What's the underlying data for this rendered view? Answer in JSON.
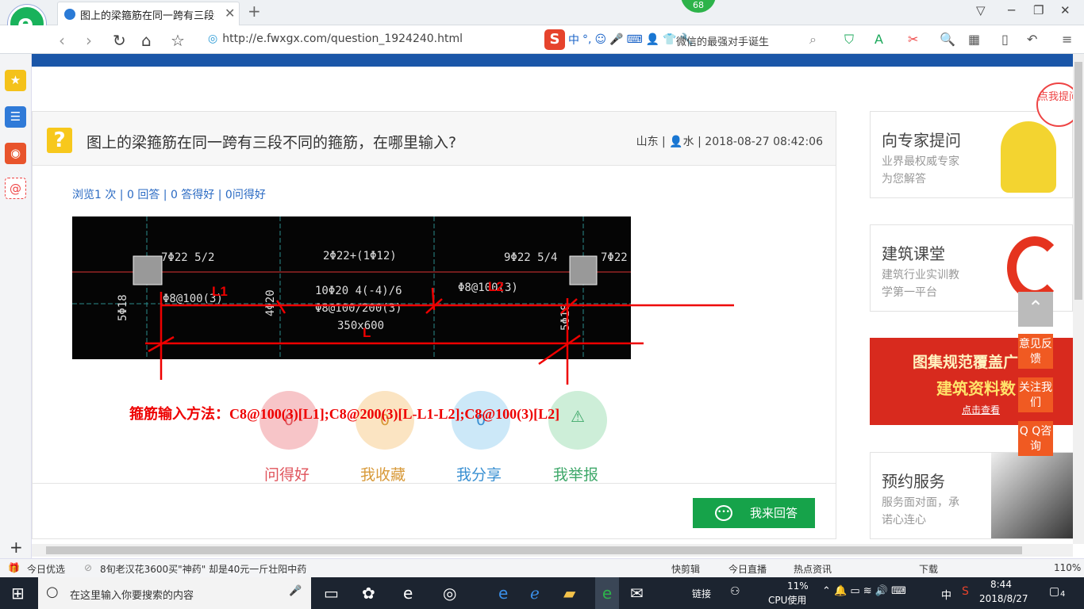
{
  "browser": {
    "tab_title": "图上的梁箍筋在同一跨有三段不同的箍筋",
    "tab_close": "✕",
    "new_tab": "+",
    "badge": "68",
    "url": "http://e.fwxgx.com/question_1924240.html",
    "ime_label": "中",
    "search_text": "微信的最强对手诞生",
    "window_buttons": [
      "▽",
      "─",
      "❐",
      "✕"
    ]
  },
  "question": {
    "icon": "?",
    "title": "图上的梁箍筋在同一跨有三段不同的箍筋，在哪里输入?",
    "meta_location": "山东",
    "meta_user": "水",
    "meta_time": "2018-08-27 08:42:06",
    "stats": "浏览1 次 | 0 回答 | 0 答得好 | 0问得好",
    "method": "箍筋输入方法：C8@100(3)[L1];C8@200(3)[L-L1-L2];C8@100(3)[L2]",
    "cad_labels": {
      "top_left": "7Φ22 5/2",
      "top_mid": "2Φ22+(1Φ12)",
      "top_right": "9Φ22 5/4",
      "top_far_right": "7Φ22",
      "mid_a": "10Φ20 4(-4)/6",
      "mid_b": "Φ8@100/200(3)",
      "mid_c": "350x600",
      "left_stirrup": "Φ8@100(3)",
      "right_stirrup": "Φ8@100(3)",
      "col_left": "5Φ18",
      "col_mid": "4Φ20",
      "col_right": "5Φ18",
      "L1": "L1",
      "L2": "L2",
      "L": "L"
    },
    "actions": [
      {
        "count": "0",
        "label": "问得好",
        "color": "#f7c5c8",
        "text_color": "#e0545c"
      },
      {
        "count": "0",
        "label": "我收藏",
        "color": "#fbe4c2",
        "text_color": "#d89a3a"
      },
      {
        "count": "0",
        "label": "我分享",
        "color": "#cce8f8",
        "text_color": "#3a90d2"
      },
      {
        "count": "",
        "label": "我举报",
        "color": "#cdeed8",
        "text_color": "#3fa86a"
      }
    ],
    "answer_button": "我来回答"
  },
  "sidebar": {
    "cards": [
      {
        "title": "向专家提问",
        "sub": [
          "业界最权威专家",
          "为您解答"
        ]
      },
      {
        "title": "建筑课堂",
        "sub": [
          "建筑行业实训教",
          "学第一平台"
        ]
      },
      {
        "title": "图集规范覆盖广",
        "sub2": "建筑资料数",
        "link": "点击查看"
      },
      {
        "title": "预约服务",
        "sub": [
          "服务面对面，承",
          "诺心连心"
        ]
      }
    ],
    "floating": [
      "意见反馈",
      "关注我们",
      "Q Q咨询"
    ],
    "bubble": "点我提问"
  },
  "statusbar": {
    "left": "今日优选",
    "news": "8旬老汉花3600买\"神药\" 却是40元一斤壮阳中药",
    "items": [
      "快剪辑",
      "今日直播",
      "热点资讯",
      "下载"
    ],
    "zoom": "110%"
  },
  "taskbar": {
    "search_placeholder": "在这里输入你要搜索的内容",
    "link_label": "链接",
    "cpu": "11%",
    "cpu_label": "CPU使用",
    "ime": "中",
    "time": "8:44",
    "date": "2018/8/27",
    "notifications": "4"
  },
  "colors": {
    "accent": "#1a56a8",
    "green": "#16a34a",
    "orange": "#f05a22",
    "red": "#e00"
  }
}
